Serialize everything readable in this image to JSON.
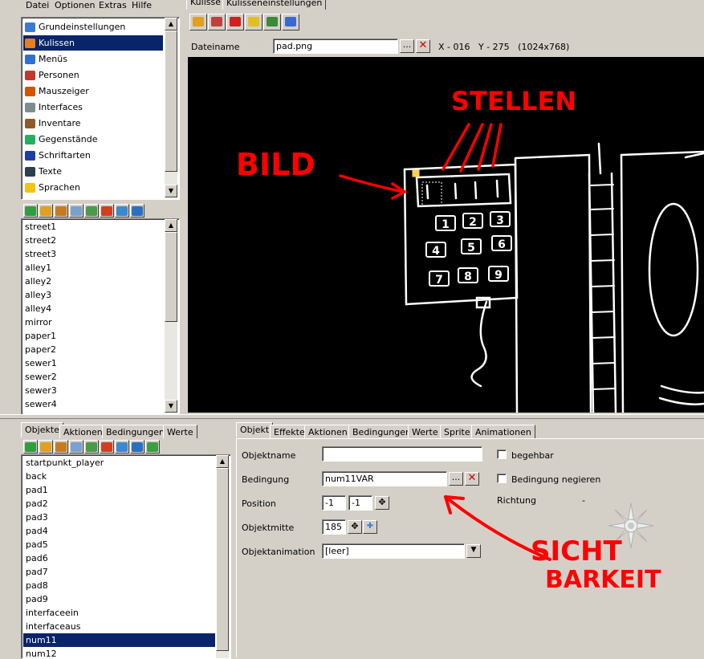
{
  "menu": [
    "Datei",
    "Optionen",
    "Extras",
    "Hilfe"
  ],
  "nav_items": [
    {
      "label": "Grundeinstellungen",
      "icon": "globe-icon",
      "color": "#3a7bd5"
    },
    {
      "label": "Kulissen",
      "icon": "house-icon",
      "color": "#e67e22",
      "selected": true
    },
    {
      "label": "Menüs",
      "icon": "menu-icon",
      "color": "#2f6fd0"
    },
    {
      "label": "Personen",
      "icon": "people-icon",
      "color": "#c0392b"
    },
    {
      "label": "Mauszeiger",
      "icon": "cursor-icon",
      "color": "#d35400"
    },
    {
      "label": "Interfaces",
      "icon": "mouse-icon",
      "color": "#7f8c8d"
    },
    {
      "label": "Inventare",
      "icon": "chest-icon",
      "color": "#8e5a2b"
    },
    {
      "label": "Gegenstände",
      "icon": "items-icon",
      "color": "#27ae60"
    },
    {
      "label": "Schriftarten",
      "icon": "font-icon",
      "color": "#1f3fa0"
    },
    {
      "label": "Texte",
      "icon": "text-icon",
      "color": "#2c3e50"
    },
    {
      "label": "Sprachen",
      "icon": "speech-icon",
      "color": "#f1c40f"
    }
  ],
  "scene_list": [
    "street1",
    "street2",
    "street3",
    "alley1",
    "alley2",
    "alley3",
    "alley4",
    "mirror",
    "paper1",
    "paper2",
    "sewer1",
    "sewer2",
    "sewer3",
    "sewer4"
  ],
  "top_tabs": [
    "Kulisse",
    "Kulisseneinstellungen"
  ],
  "file": {
    "label": "Dateiname",
    "value": "pad.png",
    "browse": "...",
    "coords": "X - 016   Y - 275   (1024x768)"
  },
  "object_tabs": [
    "Objekte",
    "Aktionen",
    "Bedingungen",
    "Werte"
  ],
  "object_list": [
    "startpunkt_player",
    "back",
    "pad1",
    "pad2",
    "pad3",
    "pad4",
    "pad5",
    "pad6",
    "pad7",
    "pad8",
    "pad9",
    "interfaceein",
    "interfaceaus",
    "num11",
    "num12"
  ],
  "selected_object": "num11",
  "prop_tabs": [
    "Objekt",
    "Effekte",
    "Aktionen",
    "Bedingungen",
    "Werte",
    "Sprite",
    "Animationen"
  ],
  "props": {
    "name_label": "Objektname",
    "name_value": "",
    "cond_label": "Bedingung",
    "cond_value": "num11VAR",
    "cond_browse": "...",
    "pos_label": "Position",
    "pos_x": "-1",
    "pos_y": "-1",
    "mid_label": "Objektmitte",
    "mid_value": "185",
    "anim_label": "Objektanimation",
    "anim_value": "[leer]",
    "walkable": "begehbar",
    "negate": "Bedingung negieren",
    "direction_label": "Richtung",
    "direction_value": "-"
  },
  "annotations": {
    "bild": "BILD",
    "stellen": "STELLEN",
    "sicht": "SICHT",
    "barkeit": "BARKEIT"
  },
  "keypad": [
    "1",
    "2",
    "3",
    "4",
    "5",
    "6",
    "7",
    "8",
    "9"
  ],
  "colors": {
    "selection": "#0a246a",
    "annotation": "#ff0000",
    "canvas": "#000000"
  }
}
